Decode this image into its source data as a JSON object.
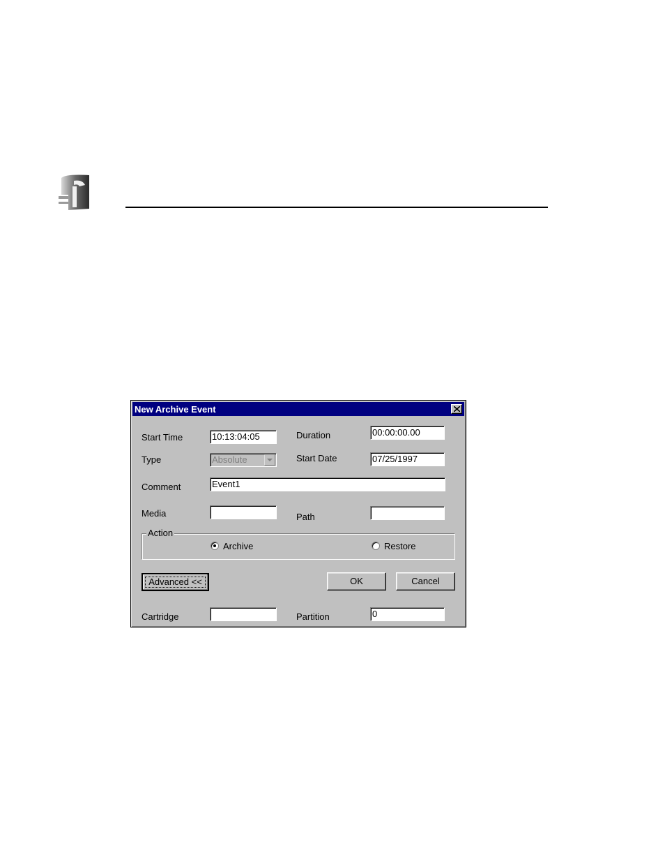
{
  "dialog": {
    "title": "New Archive Event",
    "fields": {
      "start_time": {
        "label": "Start Time",
        "value": "10:13:04:05"
      },
      "duration": {
        "label": "Duration",
        "value": "00:00:00.00"
      },
      "type": {
        "label": "Type",
        "value": "Absolute"
      },
      "start_date": {
        "label": "Start Date",
        "value": "07/25/1997"
      },
      "comment": {
        "label": "Comment",
        "value": "Event1"
      },
      "media": {
        "label": "Media",
        "value": ""
      },
      "path": {
        "label": "Path",
        "value": ""
      },
      "cartridge": {
        "label": "Cartridge",
        "value": ""
      },
      "partition": {
        "label": "Partition",
        "value": "0"
      }
    },
    "action": {
      "label": "Action",
      "options": [
        "Archive",
        "Restore"
      ],
      "selected": "Archive"
    },
    "buttons": {
      "advanced": "Advanced <<",
      "ok": "OK",
      "cancel": "Cancel"
    }
  },
  "icons": {
    "logo": "grass-valley-logo-icon",
    "close": "close-icon",
    "dropdown": "chevron-down-icon"
  }
}
